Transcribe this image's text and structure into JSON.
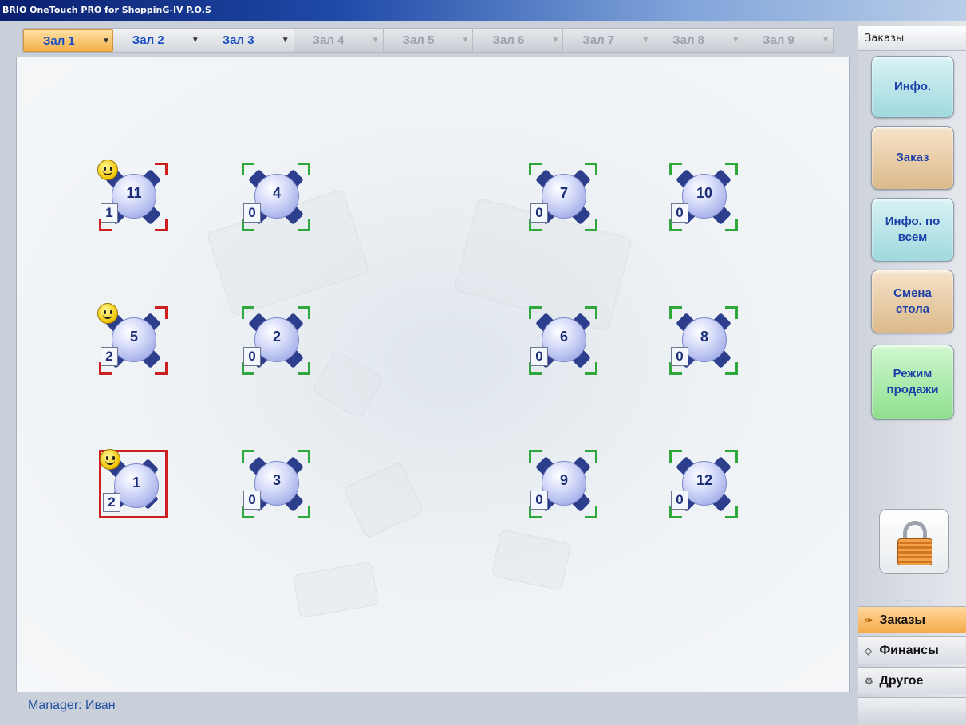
{
  "window": {
    "title": "BRIO OneTouch PRO for ShoppinG-IV P.O.S"
  },
  "tabs": [
    {
      "label": "Зал 1",
      "state": "active"
    },
    {
      "label": "Зал 2",
      "state": "enabled"
    },
    {
      "label": "Зал 3",
      "state": "enabled"
    },
    {
      "label": "Зал 4",
      "state": "disabled"
    },
    {
      "label": "Зал 5",
      "state": "disabled"
    },
    {
      "label": "Зал 6",
      "state": "disabled"
    },
    {
      "label": "Зал 7",
      "state": "disabled"
    },
    {
      "label": "Зал 8",
      "state": "disabled"
    },
    {
      "label": "Зал 9",
      "state": "disabled"
    }
  ],
  "tables": [
    {
      "number": "11",
      "guests": "1",
      "status": "occupied",
      "smiley": true
    },
    {
      "number": "4",
      "guests": "0",
      "status": "free",
      "smiley": false
    },
    {
      "number": "7",
      "guests": "0",
      "status": "free",
      "smiley": false
    },
    {
      "number": "10",
      "guests": "0",
      "status": "free",
      "smiley": false
    },
    {
      "number": "5",
      "guests": "2",
      "status": "occupied",
      "smiley": true
    },
    {
      "number": "2",
      "guests": "0",
      "status": "free",
      "smiley": false
    },
    {
      "number": "6",
      "guests": "0",
      "status": "free",
      "smiley": false
    },
    {
      "number": "8",
      "guests": "0",
      "status": "free",
      "smiley": false
    },
    {
      "number": "1",
      "guests": "2",
      "status": "occupied",
      "smiley": true
    },
    {
      "number": "3",
      "guests": "0",
      "status": "free",
      "smiley": false
    },
    {
      "number": "9",
      "guests": "0",
      "status": "free",
      "smiley": false
    },
    {
      "number": "12",
      "guests": "0",
      "status": "free",
      "smiley": false
    }
  ],
  "status": {
    "manager": "Manager: Иван"
  },
  "sidebar": {
    "header": "Заказы",
    "buttons": [
      {
        "label": "Инфо.",
        "color": "#a9dfe4"
      },
      {
        "label": "Заказ",
        "color": "#e2c49c"
      },
      {
        "label": "Инфо. по всем",
        "color": "#a9dfe4"
      },
      {
        "label": "Смена стола",
        "color": "#e2c49c"
      },
      {
        "label": "Режим продажи",
        "color": "#9fe59f"
      }
    ],
    "lock_icon": "padlock-icon",
    "dots": "..........",
    "nav": [
      {
        "label": "Заказы",
        "icon": "orders-icon",
        "active": true
      },
      {
        "label": "Финансы",
        "icon": "finance-icon",
        "active": false
      },
      {
        "label": "Другое",
        "icon": "other-icon",
        "active": false
      }
    ]
  },
  "colors": {
    "free": "#2ea83a",
    "occupied": "#cc1f1f",
    "active_tab": "#f4b04a",
    "link_blue": "#1a4fc2"
  }
}
